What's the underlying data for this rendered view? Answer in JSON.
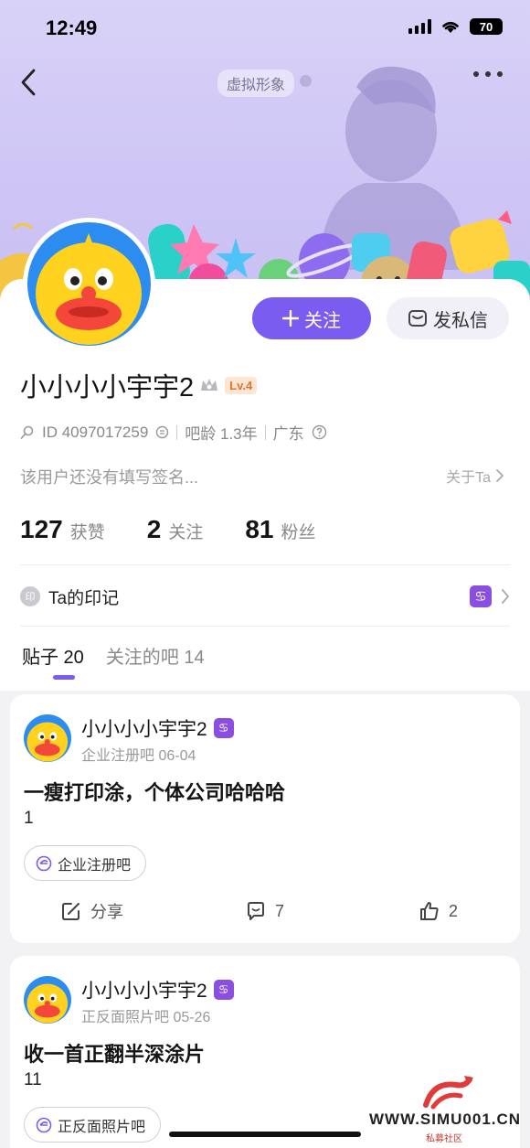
{
  "status_bar": {
    "time": "12:49",
    "battery": "70"
  },
  "header": {
    "virtual_tag": "虚拟形象"
  },
  "profile": {
    "follow_label": "关注",
    "message_label": "发私信",
    "username": "小小小小宇宇2",
    "level": "Lv.4",
    "id_text": "ID 4097017259",
    "age_text": "吧龄 1.3年",
    "location": "广东",
    "signature": "该用户还没有填写签名...",
    "about_link": "关于Ta",
    "stats": [
      {
        "num": "127",
        "label": "获赞"
      },
      {
        "num": "2",
        "label": "关注"
      },
      {
        "num": "81",
        "label": "粉丝"
      }
    ],
    "imprint_icon": "印",
    "imprint_label": "Ta的印记",
    "zodiac": "♋"
  },
  "tabs": [
    {
      "label": "贴子 20"
    },
    {
      "label": "关注的吧 14"
    }
  ],
  "posts": [
    {
      "author": "小小小小宇宇2",
      "forum_date": "企业注册吧   06-04",
      "title": "一瘦打印涂，个体公司哈哈哈",
      "body": "1",
      "forum_chip": "企业注册吧",
      "share_label": "分享",
      "comments": "7",
      "likes": "2"
    },
    {
      "author": "小小小小宇宇2",
      "forum_date": "正反面照片吧   05-26",
      "title": "收一首正翻半深涂片",
      "body": "11",
      "forum_chip": "正反面照片吧"
    }
  ],
  "watermark": {
    "text": "WWW.SIMU001.CN",
    "sub": "私募社区"
  }
}
